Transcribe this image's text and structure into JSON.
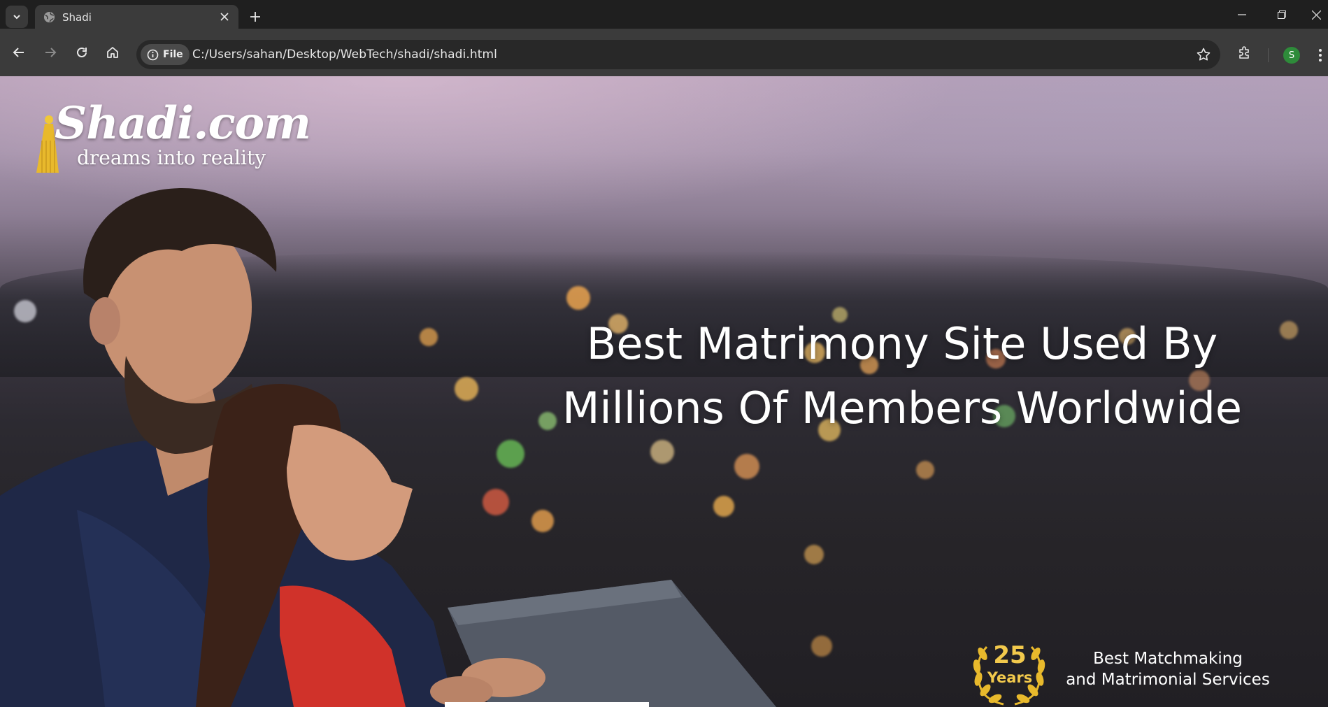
{
  "browser": {
    "tab": {
      "title": "Shadi"
    },
    "address_bar": {
      "chip_label": "File",
      "url": "C:/Users/sahan/Desktop/WebTech/shadi/shadi.html"
    },
    "profile_initial": "S"
  },
  "icons": {
    "tab_list": "chevron-down-icon",
    "favicon": "globe-icon",
    "tab_close": "close-icon",
    "new_tab": "plus-icon",
    "back": "arrow-left-icon",
    "forward": "arrow-right-icon",
    "reload": "reload-icon",
    "home": "home-icon",
    "site_info": "info-icon",
    "bookmark": "star-icon",
    "extensions": "puzzle-icon",
    "menu": "kebab-menu-icon",
    "minimize": "minimize-icon",
    "maximize": "restore-icon",
    "close_window": "close-icon"
  },
  "hero": {
    "logo": {
      "name": "Shadi.com",
      "tagline": "dreams into reality"
    },
    "headline": {
      "line1": "Best Matrimony Site Used By",
      "line2": "Millions Of Members Worldwide"
    },
    "badge": {
      "number": "25",
      "label": "Years"
    },
    "tagline": {
      "line1": "Best Matchmaking",
      "line2": "and Matrimonial Services"
    }
  },
  "colors": {
    "chrome_dark": "#1f1f1f",
    "toolbar": "#3b3b3b",
    "badge_gold": "#f2c94c",
    "profile_green": "#2e8b3a"
  }
}
